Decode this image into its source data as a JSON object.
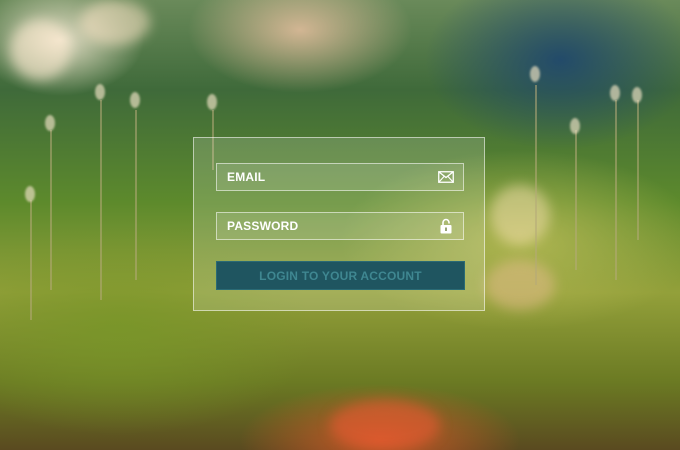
{
  "login_form": {
    "email": {
      "placeholder": "EMAIL",
      "value": "",
      "icon": "envelope-icon"
    },
    "password": {
      "placeholder": "PASSWORD",
      "value": "",
      "icon": "lock-icon"
    },
    "submit_label": "LOGIN TO YOUR ACCOUNT"
  },
  "colors": {
    "button_background": "#1f5560",
    "button_text": "#3f8791",
    "field_text": "#ffffff"
  }
}
